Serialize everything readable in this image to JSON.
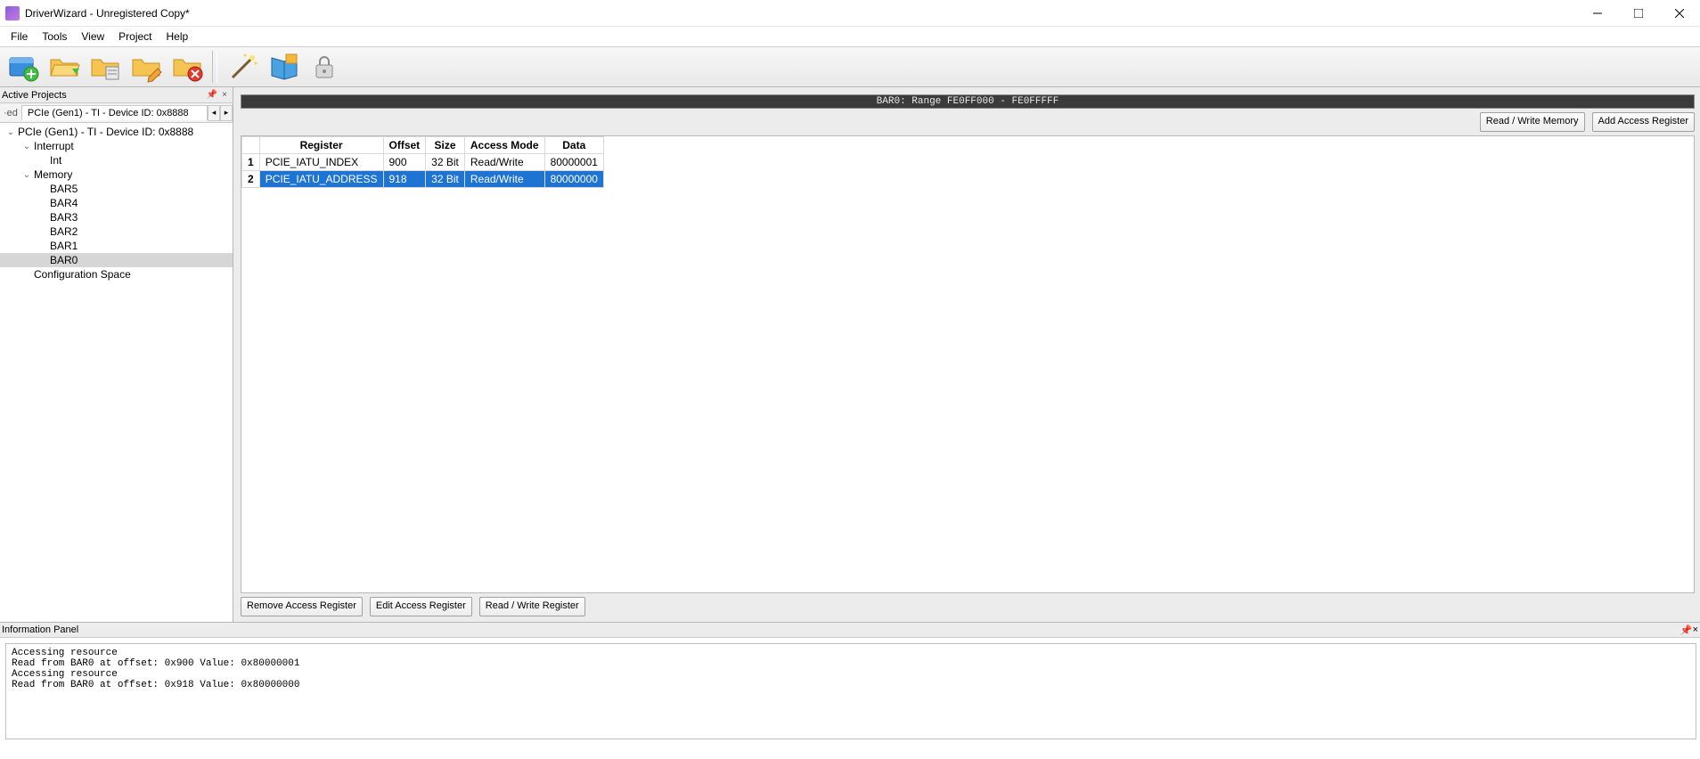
{
  "window": {
    "title": "DriverWizard - Unregistered Copy*"
  },
  "menu": {
    "file": "File",
    "tools": "Tools",
    "view": "View",
    "project": "Project",
    "help": "Help"
  },
  "toolbar_icons": {
    "new_project": "new-project-icon",
    "open_project": "open-project-icon",
    "explore": "folder-explore-icon",
    "edit_folder": "folder-edit-icon",
    "delete_folder": "folder-delete-icon",
    "wizard": "wand-icon",
    "book": "book-icon",
    "lock": "lock-icon"
  },
  "sidebar": {
    "title": "Active Projects",
    "tabstrip": {
      "crop": "·ed",
      "active_tab": "PCIe (Gen1) - TI - Device ID: 0x8888"
    },
    "tree": {
      "root": "PCIe (Gen1) - TI - Device ID: 0x8888",
      "interrupt": "Interrupt",
      "int": "Int",
      "memory": "Memory",
      "bar5": "BAR5",
      "bar4": "BAR4",
      "bar3": "BAR3",
      "bar2": "BAR2",
      "bar1": "BAR1",
      "bar0": "BAR0",
      "cfg": "Configuration Space"
    }
  },
  "content": {
    "bar_header": "BAR0: Range FE0FF000 - FE0FFFFF",
    "buttons": {
      "read_write_memory": "Read / Write Memory",
      "add_access_register": "Add Access Register",
      "remove_access_register": "Remove Access Register",
      "edit_access_register": "Edit Access Register",
      "read_write_register": "Read / Write Register"
    },
    "grid": {
      "headers": {
        "register": "Register",
        "offset": "Offset",
        "size": "Size",
        "access": "Access Mode",
        "data": "Data"
      },
      "rows": [
        {
          "num": "1",
          "register": "PCIE_IATU_INDEX",
          "offset": "900",
          "size": "32 Bit",
          "access": "Read/Write",
          "data": "80000001",
          "selected": false
        },
        {
          "num": "2",
          "register": "PCIE_IATU_ADDRESS",
          "offset": "918",
          "size": "32 Bit",
          "access": "Read/Write",
          "data": "80000000",
          "selected": true
        }
      ]
    }
  },
  "info": {
    "title": "Information Panel",
    "lines": [
      "Accessing resource",
      "Read from BAR0 at offset: 0x900 Value: 0x80000001",
      "Accessing resource",
      "Read from BAR0 at offset: 0x918 Value: 0x80000000"
    ]
  }
}
